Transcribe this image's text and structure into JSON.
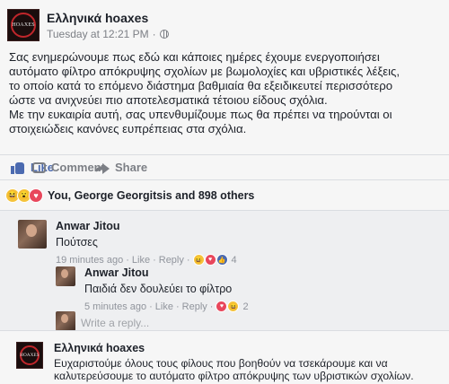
{
  "post": {
    "page_name": "Ελληνικά hoaxes",
    "avatar_text": "HOAXES",
    "timestamp": "Tuesday at 12:21 PM",
    "separator": "·",
    "body_lines": [
      "Σας ενημερώνουμε πως εδώ και κάποιες ημέρες έχουμε ενεργοποιήσει",
      "αυτόματο φίλτρο απόκρυψης σχολίων με βωμολοχίες και υβριστικές λέξεις,",
      "το οποίο κατά το επόμενο διάστημα βαθμιαία θα εξειδικευτεί περισσότερο",
      "ώστε να ανιχνεύει πιο αποτελεσματικά τέτοιου είδους σχόλια.",
      "Με την ευκαιρία αυτή, σας υπενθυμίζουμε πως θα πρέπει να τηρούνται οι",
      "στοιχειώδεις κανόνες ευπρέπειας στα σχόλια."
    ]
  },
  "actions": {
    "like": "Like",
    "comment": "Comment",
    "share": "Share"
  },
  "reactions": {
    "summary": "You, George Georgitsis and 898 others"
  },
  "comments": [
    {
      "name": "Anwar Jitou",
      "text": "Πούτσες",
      "time": "19 minutes ago",
      "like": "Like",
      "reply": "Reply",
      "reaction_count": "4"
    },
    {
      "name": "Anwar Jitou",
      "text": "Παιδιά δεν δουλεύει το φίλτρο",
      "time": "5 minutes ago",
      "like": "Like",
      "reply": "Reply",
      "reaction_count": "2"
    }
  ],
  "reply_box": {
    "placeholder": "Write a reply..."
  },
  "page_comment": {
    "name": "Ελληνικά hoaxes",
    "avatar_text": "HOAXES",
    "text_lines": [
      "Ευχαριστούμε όλους τους φίλους που βοηθούν να τσεκάρουμε και να",
      "καλυτερεύσουμε το αυτόματο φίλτρο απόκρυψης των υβριστικών σχολίων."
    ]
  },
  "colors": {
    "like_blue": "#4b6ab0",
    "muted": "#7c7f85",
    "love": "#e8475c",
    "haha": "#f5c33b",
    "avatar_ring": "#c0262b"
  }
}
